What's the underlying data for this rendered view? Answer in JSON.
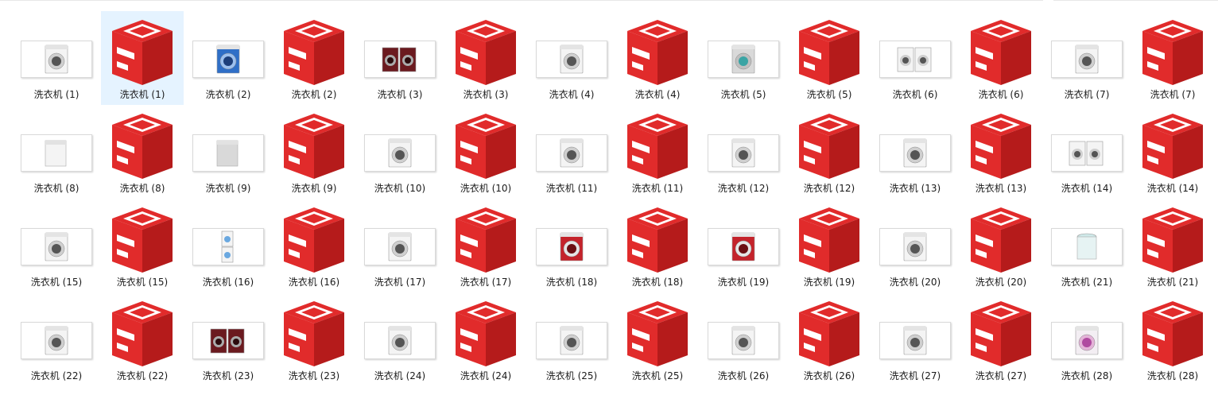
{
  "window": {
    "view": "large-icons"
  },
  "colors": {
    "selection": "#e5f3ff",
    "sketchup_red": "#e12b2b",
    "sketchup_dark": "#b51b1b"
  },
  "files": [
    {
      "label": "洗衣机 (1)",
      "type": "image",
      "icon": "washer-front-white"
    },
    {
      "label": "洗衣机 (1)",
      "type": "skp",
      "icon": "sketchup-file-icon",
      "selected": true
    },
    {
      "label": "洗衣机 (2)",
      "type": "image",
      "icon": "washer-front-blue"
    },
    {
      "label": "洗衣机 (2)",
      "type": "skp",
      "icon": "sketchup-file-icon"
    },
    {
      "label": "洗衣机 (3)",
      "type": "image",
      "icon": "washer-pair-darkred"
    },
    {
      "label": "洗衣机 (3)",
      "type": "skp",
      "icon": "sketchup-file-icon"
    },
    {
      "label": "洗衣机 (4)",
      "type": "image",
      "icon": "washer-front-white"
    },
    {
      "label": "洗衣机 (4)",
      "type": "skp",
      "icon": "sketchup-file-icon"
    },
    {
      "label": "洗衣机 (5)",
      "type": "image",
      "icon": "washer-front-grey"
    },
    {
      "label": "洗衣机 (5)",
      "type": "skp",
      "icon": "sketchup-file-icon"
    },
    {
      "label": "洗衣机 (6)",
      "type": "image",
      "icon": "washer-pair-white"
    },
    {
      "label": "洗衣机 (6)",
      "type": "skp",
      "icon": "sketchup-file-icon"
    },
    {
      "label": "洗衣机 (7)",
      "type": "image",
      "icon": "washer-front-white"
    },
    {
      "label": "洗衣机 (7)",
      "type": "skp",
      "icon": "sketchup-file-icon"
    },
    {
      "label": "洗衣机 (8)",
      "type": "image",
      "icon": "washer-top-white"
    },
    {
      "label": "洗衣机 (8)",
      "type": "skp",
      "icon": "sketchup-file-icon"
    },
    {
      "label": "洗衣机 (9)",
      "type": "image",
      "icon": "washer-top-grey"
    },
    {
      "label": "洗衣机 (9)",
      "type": "skp",
      "icon": "sketchup-file-icon"
    },
    {
      "label": "洗衣机 (10)",
      "type": "image",
      "icon": "washer-front-white"
    },
    {
      "label": "洗衣机 (10)",
      "type": "skp",
      "icon": "sketchup-file-icon"
    },
    {
      "label": "洗衣机 (11)",
      "type": "image",
      "icon": "washer-front-white"
    },
    {
      "label": "洗衣机 (11)",
      "type": "skp",
      "icon": "sketchup-file-icon"
    },
    {
      "label": "洗衣机 (12)",
      "type": "image",
      "icon": "washer-front-white"
    },
    {
      "label": "洗衣机 (12)",
      "type": "skp",
      "icon": "sketchup-file-icon"
    },
    {
      "label": "洗衣机 (13)",
      "type": "image",
      "icon": "washer-front-white"
    },
    {
      "label": "洗衣机 (13)",
      "type": "skp",
      "icon": "sketchup-file-icon"
    },
    {
      "label": "洗衣机 (14)",
      "type": "image",
      "icon": "washer-pair-white"
    },
    {
      "label": "洗衣机 (14)",
      "type": "skp",
      "icon": "sketchup-file-icon"
    },
    {
      "label": "洗衣机 (15)",
      "type": "image",
      "icon": "washer-front-white"
    },
    {
      "label": "洗衣机 (15)",
      "type": "skp",
      "icon": "sketchup-file-icon"
    },
    {
      "label": "洗衣机 (16)",
      "type": "image",
      "icon": "washer-stack-white"
    },
    {
      "label": "洗衣机 (16)",
      "type": "skp",
      "icon": "sketchup-file-icon"
    },
    {
      "label": "洗衣机 (17)",
      "type": "image",
      "icon": "washer-front-white"
    },
    {
      "label": "洗衣机 (17)",
      "type": "skp",
      "icon": "sketchup-file-icon"
    },
    {
      "label": "洗衣机 (18)",
      "type": "image",
      "icon": "washer-front-red"
    },
    {
      "label": "洗衣机 (18)",
      "type": "skp",
      "icon": "sketchup-file-icon"
    },
    {
      "label": "洗衣机 (19)",
      "type": "image",
      "icon": "washer-front-red"
    },
    {
      "label": "洗衣机 (19)",
      "type": "skp",
      "icon": "sketchup-file-icon"
    },
    {
      "label": "洗衣机 (20)",
      "type": "image",
      "icon": "washer-front-white"
    },
    {
      "label": "洗衣机 (20)",
      "type": "skp",
      "icon": "sketchup-file-icon"
    },
    {
      "label": "洗衣机 (21)",
      "type": "image",
      "icon": "washer-top-round"
    },
    {
      "label": "洗衣机 (21)",
      "type": "skp",
      "icon": "sketchup-file-icon"
    },
    {
      "label": "洗衣机 (22)",
      "type": "image",
      "icon": "washer-front-white"
    },
    {
      "label": "洗衣机 (22)",
      "type": "skp",
      "icon": "sketchup-file-icon"
    },
    {
      "label": "洗衣机 (23)",
      "type": "image",
      "icon": "washer-pair-darkred"
    },
    {
      "label": "洗衣机 (23)",
      "type": "skp",
      "icon": "sketchup-file-icon"
    },
    {
      "label": "洗衣机 (24)",
      "type": "image",
      "icon": "washer-front-white"
    },
    {
      "label": "洗衣机 (24)",
      "type": "skp",
      "icon": "sketchup-file-icon"
    },
    {
      "label": "洗衣机 (25)",
      "type": "image",
      "icon": "washer-front-white"
    },
    {
      "label": "洗衣机 (25)",
      "type": "skp",
      "icon": "sketchup-file-icon"
    },
    {
      "label": "洗衣机 (26)",
      "type": "image",
      "icon": "washer-front-white"
    },
    {
      "label": "洗衣机 (26)",
      "type": "skp",
      "icon": "sketchup-file-icon"
    },
    {
      "label": "洗衣机 (27)",
      "type": "image",
      "icon": "washer-front-white"
    },
    {
      "label": "洗衣机 (27)",
      "type": "skp",
      "icon": "sketchup-file-icon"
    },
    {
      "label": "洗衣机 (28)",
      "type": "image",
      "icon": "washer-front-pink"
    },
    {
      "label": "洗衣机 (28)",
      "type": "skp",
      "icon": "sketchup-file-icon"
    }
  ]
}
